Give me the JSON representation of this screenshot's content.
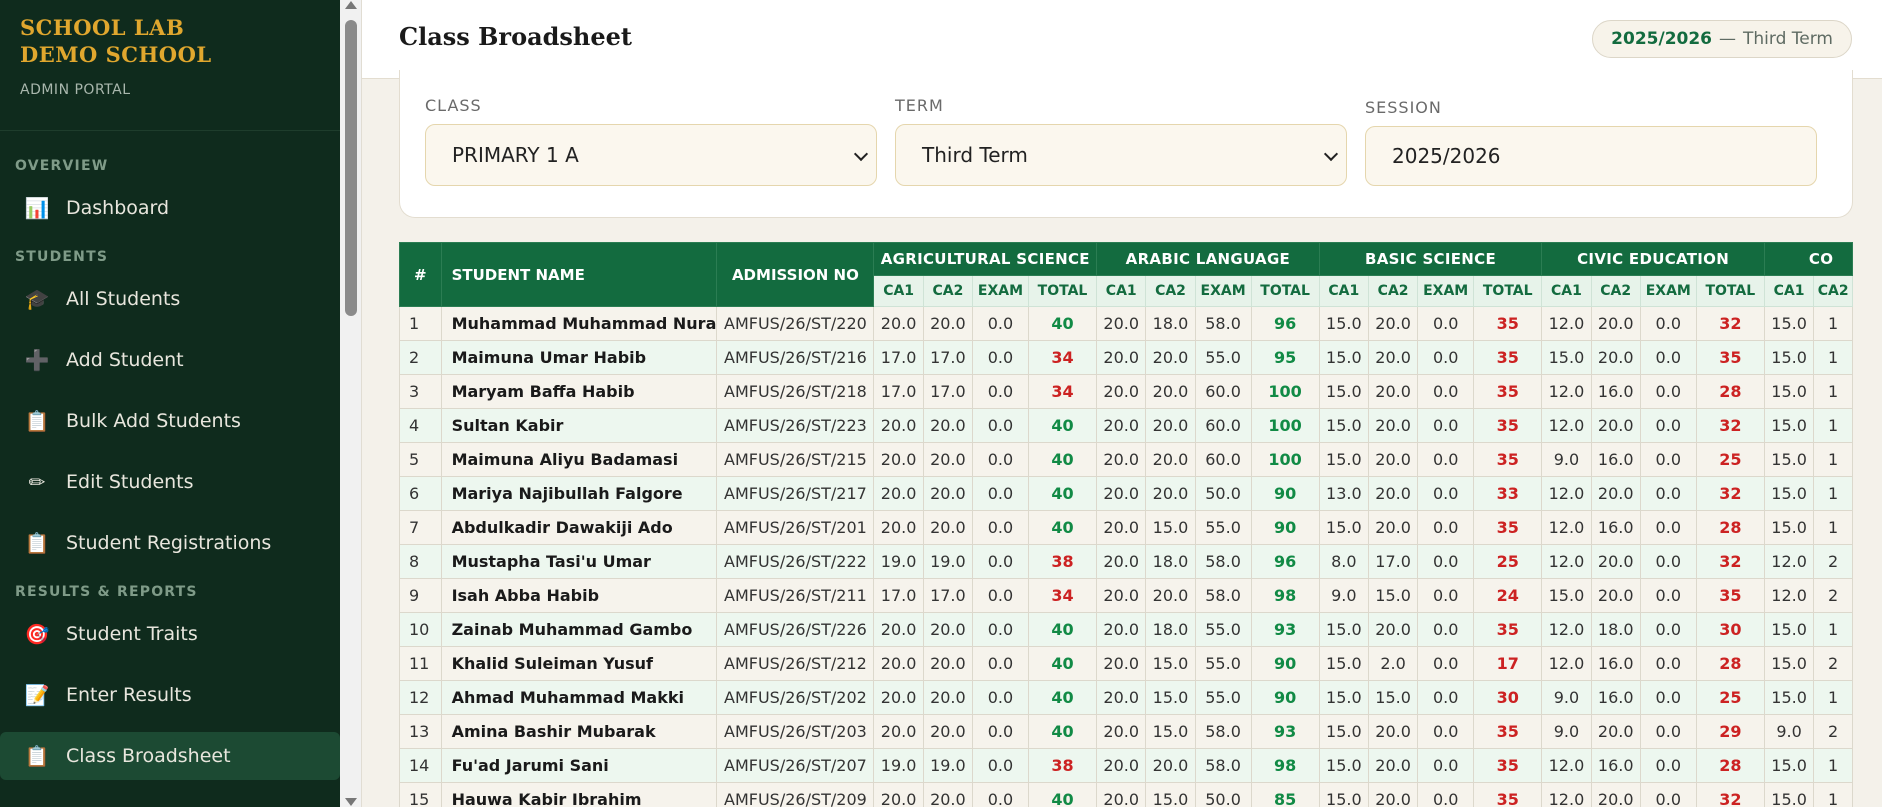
{
  "brand": {
    "name_line1": "SCHOOL LAB",
    "name_line2": "DEMO SCHOOL",
    "portal": "ADMIN PORTAL"
  },
  "sidebar": {
    "sections": [
      {
        "title": "OVERVIEW",
        "items": [
          {
            "label": "Dashboard",
            "icon": "chart-icon",
            "glyph": "📊"
          }
        ]
      },
      {
        "title": "STUDENTS",
        "items": [
          {
            "label": "All Students",
            "icon": "graduation-cap-icon",
            "glyph": "🎓"
          },
          {
            "label": "Add Student",
            "icon": "plus-icon",
            "glyph": "➕"
          },
          {
            "label": "Bulk Add Students",
            "icon": "clipboard-icon",
            "glyph": "📋"
          },
          {
            "label": "Edit Students",
            "icon": "pencil-icon",
            "glyph": "✏"
          },
          {
            "label": "Student Registrations",
            "icon": "clipboard-icon",
            "glyph": "📋"
          }
        ]
      },
      {
        "title": "RESULTS & REPORTS",
        "items": [
          {
            "label": "Student Traits",
            "icon": "target-icon",
            "glyph": "🎯"
          },
          {
            "label": "Enter Results",
            "icon": "memo-icon",
            "glyph": "📝"
          },
          {
            "label": "Class Broadsheet",
            "icon": "clipboard-icon",
            "glyph": "📋",
            "active": true
          }
        ]
      }
    ]
  },
  "header": {
    "title": "Class Broadsheet",
    "session_year": "2025/2026",
    "session_separator": "—",
    "session_term": "Third Term"
  },
  "filters": {
    "class_label": "CLASS",
    "class_value": "PRIMARY 1 A",
    "term_label": "TERM",
    "term_value": "Third Term",
    "session_label": "SESSION",
    "session_value": "2025/2026"
  },
  "table": {
    "col_index": "#",
    "col_name": "STUDENT NAME",
    "col_adm": "ADMISSION NO",
    "subjects": [
      "AGRICULTURAL SCIENCE",
      "ARABIC LANGUAGE",
      "BASIC SCIENCE",
      "CIVIC EDUCATION",
      "CO"
    ],
    "sub_headers": [
      "CA1",
      "CA2",
      "EXAM",
      "TOTAL"
    ],
    "pass_color": "#118a45",
    "fail_color": "#cc2222",
    "header_color": "#136b3f",
    "rows": [
      {
        "n": "1",
        "name": "Muhammad Muhammad Nura",
        "adm": "AMFUS/26/ST/220",
        "s": [
          [
            "20.0",
            "20.0",
            "0.0",
            "40"
          ],
          [
            "20.0",
            "18.0",
            "58.0",
            "96"
          ],
          [
            "15.0",
            "20.0",
            "0.0",
            "35"
          ],
          [
            "12.0",
            "20.0",
            "0.0",
            "32"
          ],
          [
            "15.0",
            "1"
          ]
        ]
      },
      {
        "n": "2",
        "name": "Maimuna Umar Habib",
        "adm": "AMFUS/26/ST/216",
        "s": [
          [
            "17.0",
            "17.0",
            "0.0",
            "34"
          ],
          [
            "20.0",
            "20.0",
            "55.0",
            "95"
          ],
          [
            "15.0",
            "20.0",
            "0.0",
            "35"
          ],
          [
            "15.0",
            "20.0",
            "0.0",
            "35"
          ],
          [
            "15.0",
            "1"
          ]
        ]
      },
      {
        "n": "3",
        "name": "Maryam Baffa Habib",
        "adm": "AMFUS/26/ST/218",
        "s": [
          [
            "17.0",
            "17.0",
            "0.0",
            "34"
          ],
          [
            "20.0",
            "20.0",
            "60.0",
            "100"
          ],
          [
            "15.0",
            "20.0",
            "0.0",
            "35"
          ],
          [
            "12.0",
            "16.0",
            "0.0",
            "28"
          ],
          [
            "15.0",
            "1"
          ]
        ]
      },
      {
        "n": "4",
        "name": "Sultan Kabir",
        "adm": "AMFUS/26/ST/223",
        "s": [
          [
            "20.0",
            "20.0",
            "0.0",
            "40"
          ],
          [
            "20.0",
            "20.0",
            "60.0",
            "100"
          ],
          [
            "15.0",
            "20.0",
            "0.0",
            "35"
          ],
          [
            "12.0",
            "20.0",
            "0.0",
            "32"
          ],
          [
            "15.0",
            "1"
          ]
        ]
      },
      {
        "n": "5",
        "name": "Maimuna Aliyu Badamasi",
        "adm": "AMFUS/26/ST/215",
        "s": [
          [
            "20.0",
            "20.0",
            "0.0",
            "40"
          ],
          [
            "20.0",
            "20.0",
            "60.0",
            "100"
          ],
          [
            "15.0",
            "20.0",
            "0.0",
            "35"
          ],
          [
            "9.0",
            "16.0",
            "0.0",
            "25"
          ],
          [
            "15.0",
            "1"
          ]
        ]
      },
      {
        "n": "6",
        "name": "Mariya Najibullah Falgore",
        "adm": "AMFUS/26/ST/217",
        "s": [
          [
            "20.0",
            "20.0",
            "0.0",
            "40"
          ],
          [
            "20.0",
            "20.0",
            "50.0",
            "90"
          ],
          [
            "13.0",
            "20.0",
            "0.0",
            "33"
          ],
          [
            "12.0",
            "20.0",
            "0.0",
            "32"
          ],
          [
            "15.0",
            "1"
          ]
        ]
      },
      {
        "n": "7",
        "name": "Abdulkadir Dawakiji Ado",
        "adm": "AMFUS/26/ST/201",
        "s": [
          [
            "20.0",
            "20.0",
            "0.0",
            "40"
          ],
          [
            "20.0",
            "15.0",
            "55.0",
            "90"
          ],
          [
            "15.0",
            "20.0",
            "0.0",
            "35"
          ],
          [
            "12.0",
            "16.0",
            "0.0",
            "28"
          ],
          [
            "15.0",
            "1"
          ]
        ]
      },
      {
        "n": "8",
        "name": "Mustapha Tasi'u Umar",
        "adm": "AMFUS/26/ST/222",
        "s": [
          [
            "19.0",
            "19.0",
            "0.0",
            "38"
          ],
          [
            "20.0",
            "18.0",
            "58.0",
            "96"
          ],
          [
            "8.0",
            "17.0",
            "0.0",
            "25"
          ],
          [
            "12.0",
            "20.0",
            "0.0",
            "32"
          ],
          [
            "12.0",
            "2"
          ]
        ]
      },
      {
        "n": "9",
        "name": "Isah Abba Habib",
        "adm": "AMFUS/26/ST/211",
        "s": [
          [
            "17.0",
            "17.0",
            "0.0",
            "34"
          ],
          [
            "20.0",
            "20.0",
            "58.0",
            "98"
          ],
          [
            "9.0",
            "15.0",
            "0.0",
            "24"
          ],
          [
            "15.0",
            "20.0",
            "0.0",
            "35"
          ],
          [
            "12.0",
            "2"
          ]
        ]
      },
      {
        "n": "10",
        "name": "Zainab Muhammad Gambo",
        "adm": "AMFUS/26/ST/226",
        "s": [
          [
            "20.0",
            "20.0",
            "0.0",
            "40"
          ],
          [
            "20.0",
            "18.0",
            "55.0",
            "93"
          ],
          [
            "15.0",
            "20.0",
            "0.0",
            "35"
          ],
          [
            "12.0",
            "18.0",
            "0.0",
            "30"
          ],
          [
            "15.0",
            "1"
          ]
        ]
      },
      {
        "n": "11",
        "name": "Khalid Suleiman Yusuf",
        "adm": "AMFUS/26/ST/212",
        "s": [
          [
            "20.0",
            "20.0",
            "0.0",
            "40"
          ],
          [
            "20.0",
            "15.0",
            "55.0",
            "90"
          ],
          [
            "15.0",
            "2.0",
            "0.0",
            "17"
          ],
          [
            "12.0",
            "16.0",
            "0.0",
            "28"
          ],
          [
            "15.0",
            "2"
          ]
        ]
      },
      {
        "n": "12",
        "name": "Ahmad Muhammad Makki",
        "adm": "AMFUS/26/ST/202",
        "s": [
          [
            "20.0",
            "20.0",
            "0.0",
            "40"
          ],
          [
            "20.0",
            "15.0",
            "55.0",
            "90"
          ],
          [
            "15.0",
            "15.0",
            "0.0",
            "30"
          ],
          [
            "9.0",
            "16.0",
            "0.0",
            "25"
          ],
          [
            "15.0",
            "1"
          ]
        ]
      },
      {
        "n": "13",
        "name": "Amina Bashir Mubarak",
        "adm": "AMFUS/26/ST/203",
        "s": [
          [
            "20.0",
            "20.0",
            "0.0",
            "40"
          ],
          [
            "20.0",
            "15.0",
            "58.0",
            "93"
          ],
          [
            "15.0",
            "20.0",
            "0.0",
            "35"
          ],
          [
            "9.0",
            "20.0",
            "0.0",
            "29"
          ],
          [
            "9.0",
            "2"
          ]
        ]
      },
      {
        "n": "14",
        "name": "Fu'ad Jarumi Sani",
        "adm": "AMFUS/26/ST/207",
        "s": [
          [
            "19.0",
            "19.0",
            "0.0",
            "38"
          ],
          [
            "20.0",
            "20.0",
            "58.0",
            "98"
          ],
          [
            "15.0",
            "20.0",
            "0.0",
            "35"
          ],
          [
            "12.0",
            "16.0",
            "0.0",
            "28"
          ],
          [
            "15.0",
            "1"
          ]
        ]
      },
      {
        "n": "15",
        "name": "Hauwa Kabir Ibrahim",
        "adm": "AMFUS/26/ST/209",
        "s": [
          [
            "20.0",
            "20.0",
            "0.0",
            "40"
          ],
          [
            "20.0",
            "15.0",
            "50.0",
            "85"
          ],
          [
            "15.0",
            "20.0",
            "0.0",
            "35"
          ],
          [
            "12.0",
            "20.0",
            "0.0",
            "32"
          ],
          [
            "15.0",
            "1"
          ]
        ]
      }
    ]
  }
}
